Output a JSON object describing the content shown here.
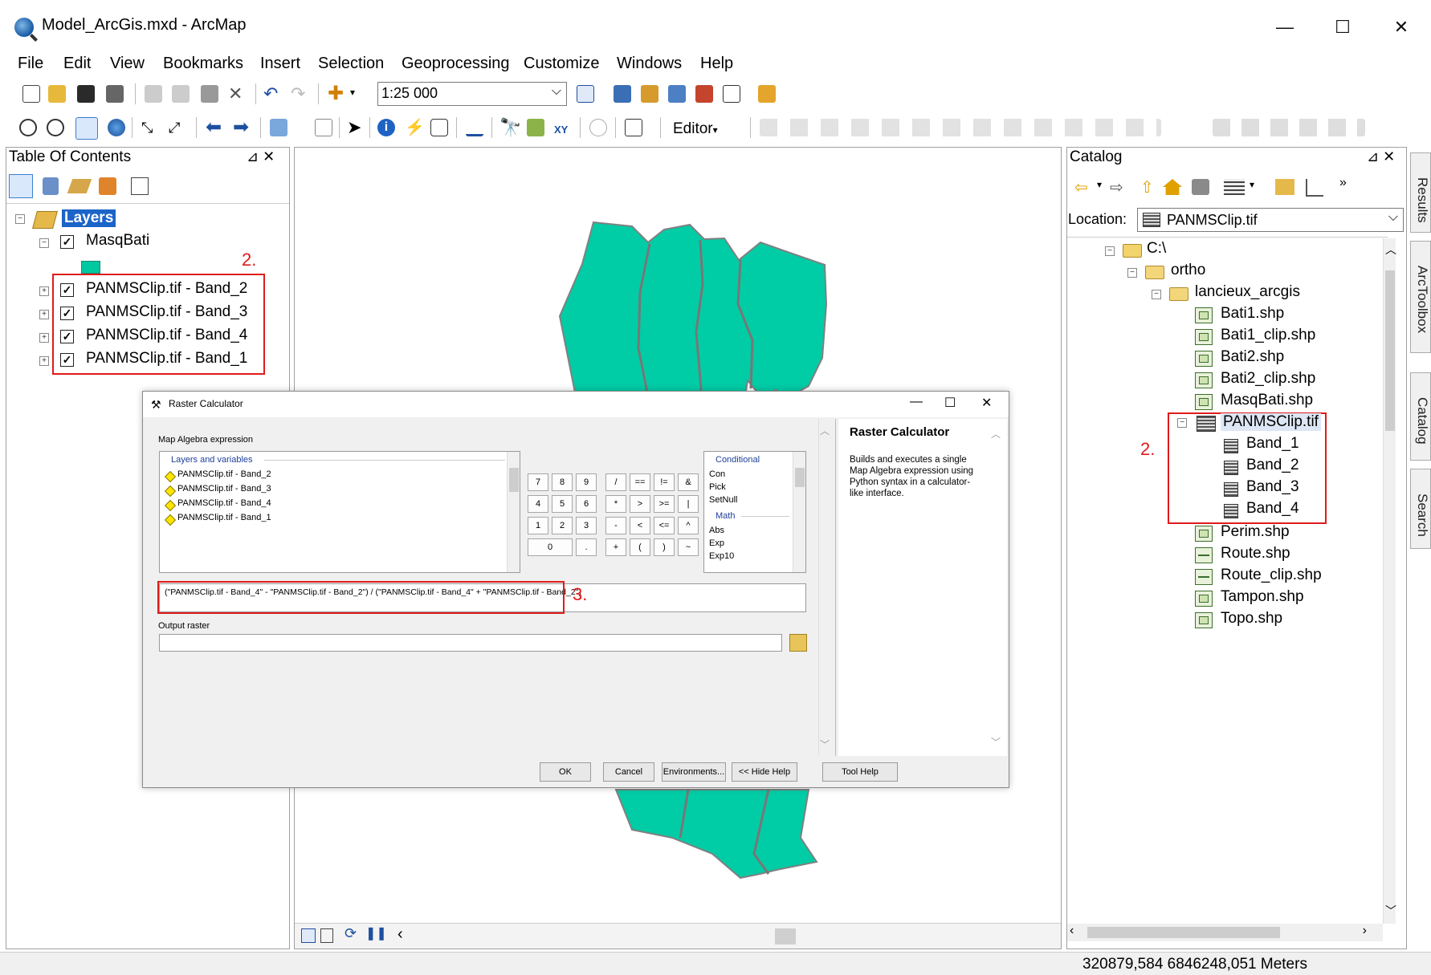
{
  "window": {
    "title": "Model_ArcGis.mxd - ArcMap",
    "minimize": "—",
    "maximize": "☐",
    "close": "✕"
  },
  "menu": [
    "File",
    "Edit",
    "View",
    "Bookmarks",
    "Insert",
    "Selection",
    "Geoprocessing",
    "Customize",
    "Windows",
    "Help"
  ],
  "toolbar": {
    "scale": "1:25 000",
    "editor_label": "Editor"
  },
  "toc": {
    "title": "Table Of Contents",
    "pin": "⊿ ✕",
    "root": "Layers",
    "layers": [
      "MasqBati",
      "PANMSClip.tif - Band_2",
      "PANMSClip.tif - Band_3",
      "PANMSClip.tif - Band_4",
      "PANMSClip.tif - Band_1"
    ],
    "masq_color": "#00c8a0",
    "annotation": "2."
  },
  "map": {
    "polygon_color": "#00cca6",
    "outline_color": "#808080"
  },
  "catalog": {
    "title": "Catalog",
    "location_label": "Location:",
    "location_value": "PANMSClip.tif",
    "tree": {
      "drive": "C:\\",
      "folder1": "ortho",
      "folder2": "lancieux_arcgis",
      "files_before": [
        "Bati1.shp",
        "Bati1_clip.shp",
        "Bati2.shp",
        "Bati2_clip.shp",
        "MasqBati.shp"
      ],
      "raster": "PANMSClip.tif",
      "bands": [
        "Band_1",
        "Band_2",
        "Band_3",
        "Band_4"
      ],
      "files_after": [
        {
          "name": "Perim.shp",
          "type": "polygon"
        },
        {
          "name": "Route.shp",
          "type": "line"
        },
        {
          "name": "Route_clip.shp",
          "type": "line"
        },
        {
          "name": "Tampon.shp",
          "type": "polygon"
        },
        {
          "name": "Topo.shp",
          "type": "polygon"
        }
      ]
    },
    "annotation": "2."
  },
  "side_tabs": [
    "Results",
    "ArcToolbox",
    "Catalog",
    "Search"
  ],
  "dialog": {
    "title": "Raster Calculator",
    "section_label": "Map Algebra expression",
    "layers_header": "Layers and variables",
    "layers": [
      "PANMSClip.tif - Band_2",
      "PANMSClip.tif - Band_3",
      "PANMSClip.tif - Band_4",
      "PANMSClip.tif - Band_1"
    ],
    "keypad": [
      [
        "7",
        "8",
        "9",
        "/",
        "==",
        "!=",
        "&"
      ],
      [
        "4",
        "5",
        "6",
        "*",
        ">",
        ">=",
        "|"
      ],
      [
        "1",
        "2",
        "3",
        "-",
        "<",
        "<=",
        "^"
      ],
      [
        "0",
        ".",
        "+",
        "(",
        ")",
        "~"
      ]
    ],
    "conditional_header": "Conditional",
    "conditional": [
      "Con",
      "Pick",
      "SetNull"
    ],
    "math_header": "Math",
    "math": [
      "Abs",
      "Exp",
      "Exp10"
    ],
    "expression": "(\"PANMSClip.tif - Band_4\" - \"PANMSClip.tif - Band_2\") / (\"PANMSClip.tif - Band_4\" + \"PANMSClip.tif - Band_2\")",
    "expression_annotation": "3.",
    "output_label": "Output raster",
    "help_title": "Raster Calculator",
    "help_text": "Builds and executes a single Map Algebra expression using Python syntax in a calculator-like interface.",
    "buttons": {
      "ok": "OK",
      "cancel": "Cancel",
      "environments": "Environments...",
      "hide_help": "<< Hide Help",
      "tool_help": "Tool Help"
    }
  },
  "status": {
    "coordinates": "320879,584  6846248,051 Meters"
  }
}
